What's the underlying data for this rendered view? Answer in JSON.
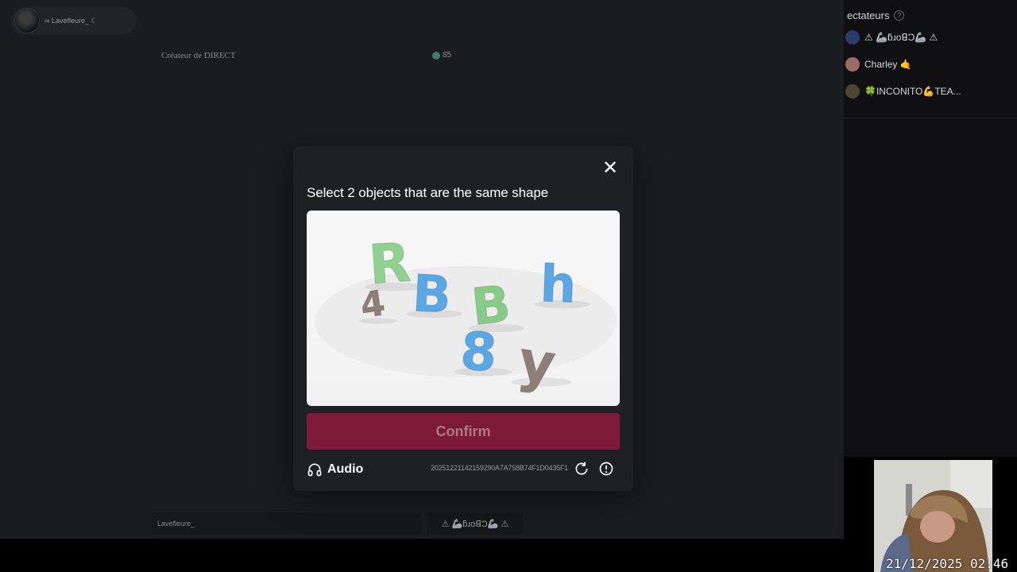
{
  "stream": {
    "host_name": "Lavefleure_",
    "host_infinity_glyph": "∞",
    "host_moon_glyph": "☾",
    "role_label": "Créateur de DIRECT",
    "coins": "85",
    "footer_host_name": "Lavefleure_",
    "footer_guest_name": "⚠ 🦾ƃɹoꓭƆ🦾 ⚠"
  },
  "captcha": {
    "close_glyph": "✕",
    "instruction": "Select 2 objects that are the same shape",
    "objects": [
      {
        "char": "R",
        "color": "#8fd18f"
      },
      {
        "char": "B",
        "color": "#5aa7e6"
      },
      {
        "char": "B",
        "color": "#86cc86"
      },
      {
        "char": "h",
        "color": "#5aa7e6"
      },
      {
        "char": "4",
        "color": "#8d7f78"
      },
      {
        "char": "8",
        "color": "#5aa7e6"
      },
      {
        "char": "y",
        "color": "#8d7f78"
      }
    ],
    "confirm_label": "Confirm",
    "audio_label": "Audio",
    "challenge_id": "20251221142159290A7A758B74F1D0435F1",
    "icons": [
      "close-icon",
      "headphones-icon",
      "refresh-icon",
      "report-icon"
    ],
    "colors": {
      "confirm_bg": "#7d1a39",
      "modal_bg": "#1f2023"
    }
  },
  "sidebar": {
    "title": "ectateurs",
    "help_glyph": "?",
    "viewers": [
      {
        "name": "⚠ 🦾ƃɹoꓭƆ🦾 ⚠"
      },
      {
        "name": "Charley 🤙"
      },
      {
        "name": "🍀INCONITO💪TEA..."
      }
    ]
  },
  "overlay": {
    "timestamp": "21/12/2025 02:46"
  }
}
